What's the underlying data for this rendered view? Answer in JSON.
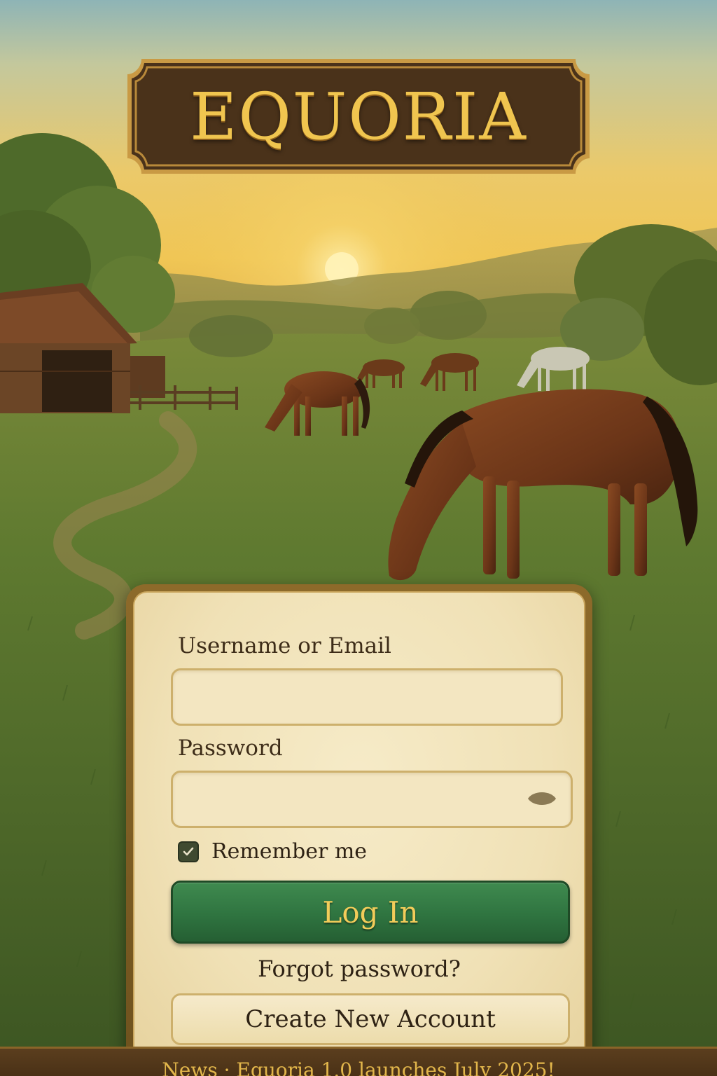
{
  "app": {
    "logo_text": "EQUORIA"
  },
  "login": {
    "username_label": "Username or Email",
    "username_value": "",
    "password_label": "Password",
    "password_value": "",
    "remember_label": "Remember me",
    "remember_checked": true,
    "login_button_label": "Log In",
    "forgot_link_label": "Forgot password?",
    "create_account_label": "Create New Account"
  },
  "news": {
    "ticker_text": "News · Equoria 1.0 launches July 2025!"
  },
  "icons": {
    "password_toggle": "eye-icon",
    "checkbox_mark": "checkmark-icon"
  },
  "colors": {
    "primary_button": "#2f7440",
    "button_text": "#f2cc5a",
    "panel_background": "#f0e1b6",
    "sign_background": "#4a321a",
    "news_bar": "#4a3116"
  }
}
